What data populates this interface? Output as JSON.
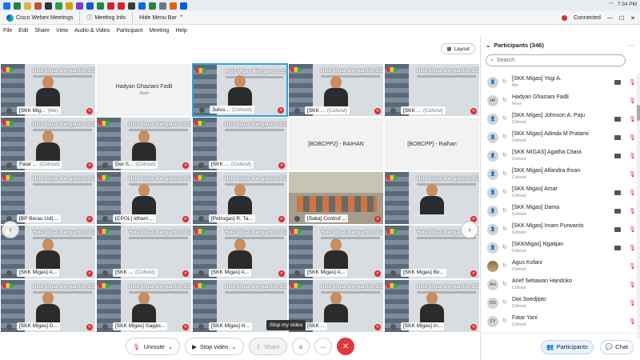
{
  "taskbar": {
    "time": "7:34 PM",
    "icons": [
      "#1f6feb",
      "#2c7c4e",
      "#e3b341",
      "#c84e2c",
      "#333333",
      "#2ea043",
      "#d2a300",
      "#7a3ccf",
      "#0c5bd6",
      "#1f883d",
      "#d1242f",
      "#d1242f",
      "#3b3b3b",
      "#0969da",
      "#2d7d46",
      "#6e7781",
      "#e36209",
      "#0c5bd6"
    ]
  },
  "tabs": {
    "app_title": "Cisco Webex Meetings",
    "meeting_info": "Meeting Info",
    "hide_menu": "Hide Menu Bar",
    "connected": "Connected"
  },
  "menu": [
    "File",
    "Edit",
    "Share",
    "View",
    "Audio & Video",
    "Participant",
    "Meeting",
    "Help"
  ],
  "stage": {
    "layout_label": "Layout",
    "poster_title": "Hulu Migas Mengambut 2021",
    "tiles": [
      {
        "kind": "poster",
        "name": "[SKK Mig...",
        "role": "(Me)",
        "muted": true
      },
      {
        "kind": "plain",
        "name": "Hadyan Ghaziani Fadli",
        "role": "Host"
      },
      {
        "kind": "poster",
        "name": "Julius...",
        "role": "(Cohost)",
        "muted": true,
        "selected": true
      },
      {
        "kind": "poster",
        "name": "[SKK ...",
        "role": "(Cohost)",
        "muted": true
      },
      {
        "kind": "poster",
        "name": "[SKK ...",
        "role": "(Cohost)",
        "muted": true
      },
      {
        "kind": "poster",
        "name": "Fatar ...",
        "role": "(Cohost)",
        "muted": true
      },
      {
        "kind": "poster",
        "name": "Dwi S...",
        "role": "(Cohost)",
        "muted": true
      },
      {
        "kind": "poster",
        "name": "[SKK ...",
        "role": "(Cohost)",
        "muted": true
      },
      {
        "kind": "plain",
        "name": "[BOBCPP2] - RAIHAN",
        "role": ""
      },
      {
        "kind": "plain",
        "name": "[BOBCPP] - Raihan",
        "role": ""
      },
      {
        "kind": "poster",
        "name": "[BP Berau Ltd] ...",
        "role": "",
        "muted": true
      },
      {
        "kind": "poster",
        "name": "[CPGL] Idham ...",
        "role": "",
        "muted": true
      },
      {
        "kind": "poster",
        "name": "[Petrogas] R. Ta...",
        "role": "",
        "muted": true
      },
      {
        "kind": "room",
        "name": "[Saka] Control'...",
        "role": "",
        "muted": true
      },
      {
        "kind": "poster",
        "name": "",
        "role": "",
        "muted": true
      },
      {
        "kind": "poster",
        "name": "[SKK Migas] A...",
        "role": "",
        "muted": true
      },
      {
        "kind": "poster",
        "name": "[SKK ...",
        "role": "(Cohost)",
        "muted": true
      },
      {
        "kind": "poster",
        "name": "[SKK Migas] A...",
        "role": "",
        "muted": true
      },
      {
        "kind": "poster",
        "name": "[SKK Migas] A...",
        "role": "",
        "muted": true
      },
      {
        "kind": "poster",
        "name": "[SKK Migas] Bir...",
        "role": "",
        "muted": true
      },
      {
        "kind": "poster",
        "name": "[SKK Migas] D...",
        "role": "",
        "muted": true
      },
      {
        "kind": "poster",
        "name": "[SKK Migas] Gagas...",
        "role": "",
        "muted": true
      },
      {
        "kind": "poster",
        "name": "[SKK Migas] H...",
        "role": "",
        "muted": true
      },
      {
        "kind": "poster",
        "name": "[SKK ...",
        "role": "",
        "muted": true
      },
      {
        "kind": "poster",
        "name": "[SKK Migas] In...",
        "role": "",
        "muted": true
      }
    ]
  },
  "toolbar": {
    "unmute": "Unmute",
    "stop_video": "Stop video",
    "share": "Share",
    "tooltip": "Stop my video"
  },
  "panel": {
    "title": "Participants (346)",
    "search_placeholder": "Search",
    "participants": [
      {
        "initials": "",
        "name": "[SKK Migas] Yogi A.",
        "role": "Me",
        "video": true
      },
      {
        "initials": "HF",
        "name": "Hadyan Ghaziani Fadli",
        "role": "Host",
        "video": false
      },
      {
        "initials": "",
        "name": "[SKK Migas] Johnson A. Paju",
        "role": "Cohost",
        "video": true
      },
      {
        "initials": "",
        "name": "[SKK Migas] Adinda M Pratami",
        "role": "Cohost",
        "video": true
      },
      {
        "initials": "",
        "name": "[SKK MIGAS] Agatha Citara",
        "role": "Cohost",
        "video": true
      },
      {
        "initials": "",
        "name": "[SKK Migas] Alfandra Ihsan",
        "role": "Cohost",
        "video": false
      },
      {
        "initials": "",
        "name": "[SKK Migas] Amar",
        "role": "Cohost",
        "video": true
      },
      {
        "initials": "",
        "name": "[SKK Migas] Dama",
        "role": "Cohost",
        "video": true
      },
      {
        "initials": "",
        "name": "[SKK Migas] Imam Purwanto",
        "role": "Cohost",
        "video": true
      },
      {
        "initials": "",
        "name": "[SKKMigas] Ngatijan",
        "role": "Cohost",
        "video": true
      },
      {
        "initials": "",
        "name": "Agus Kofani",
        "role": "Cohost",
        "video": false,
        "photo": true
      },
      {
        "initials": "AH",
        "name": "Arief Setiawan Handoko",
        "role": "Cohost",
        "video": false
      },
      {
        "initials": "DS",
        "name": "Dwi Soedjipto",
        "role": "Cohost",
        "video": false
      },
      {
        "initials": "FY",
        "name": "Fatar Yani",
        "role": "Cohost",
        "video": false
      }
    ],
    "participants_btn": "Participants",
    "chat_btn": "Chat"
  }
}
